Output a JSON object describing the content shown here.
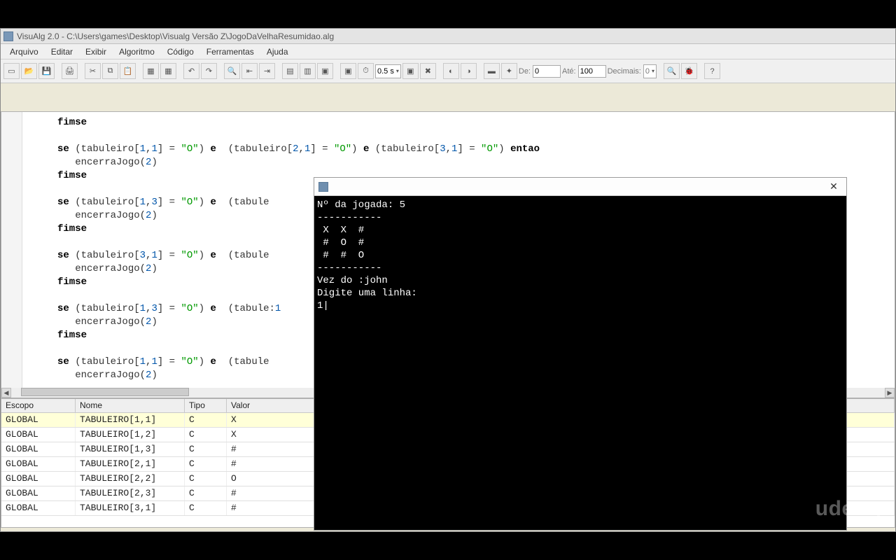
{
  "title": "VisuAlg 2.0 - C:\\Users\\games\\Desktop\\Visualg Versão Z\\JogoDaVelhaResumidao.alg",
  "menu": [
    "Arquivo",
    "Editar",
    "Exibir",
    "Algoritmo",
    "Código",
    "Ferramentas",
    "Ajuda"
  ],
  "toolbar_fields": {
    "timer_select": "0.5 s",
    "de_label": "De:",
    "de_val": "0",
    "ate_label": "Até:",
    "ate_val": "100",
    "dec_label": "Decimais:",
    "dec_val": "0"
  },
  "code_lines": [
    "fimse",
    "",
    "se (tabuleiro[1,1] = \"O\") e  (tabuleiro[2,1] = \"O\") e (tabuleiro[3,1] = \"O\") entao",
    "   encerraJogo(2)",
    "fimse",
    "",
    "se (tabuleiro[1,3] = \"O\") e  (tabule",
    "   encerraJogo(2)",
    "fimse",
    "",
    "se (tabuleiro[3,1] = \"O\") e  (tabule",
    "   encerraJogo(2)",
    "fimse",
    "",
    "se (tabuleiro[1,3] = \"O\") e  (tabule:1",
    "   encerraJogo(2)",
    "fimse",
    "",
    "se (tabuleiro[1,1] = \"O\") e  (tabule",
    "   encerraJogo(2)"
  ],
  "vars": {
    "headers": {
      "escopo": "Escopo",
      "nome": "Nome",
      "tipo": "Tipo",
      "valor": "Valor"
    },
    "rows": [
      {
        "escopo": "GLOBAL",
        "nome": "TABULEIRO[1,1]",
        "tipo": "C",
        "valor": "X",
        "hl": true
      },
      {
        "escopo": "GLOBAL",
        "nome": "TABULEIRO[1,2]",
        "tipo": "C",
        "valor": "X",
        "hl": false
      },
      {
        "escopo": "GLOBAL",
        "nome": "TABULEIRO[1,3]",
        "tipo": "C",
        "valor": "#",
        "hl": false
      },
      {
        "escopo": "GLOBAL",
        "nome": "TABULEIRO[2,1]",
        "tipo": "C",
        "valor": "#",
        "hl": false
      },
      {
        "escopo": "GLOBAL",
        "nome": "TABULEIRO[2,2]",
        "tipo": "C",
        "valor": "O",
        "hl": false
      },
      {
        "escopo": "GLOBAL",
        "nome": "TABULEIRO[2,3]",
        "tipo": "C",
        "valor": "#",
        "hl": false
      },
      {
        "escopo": "GLOBAL",
        "nome": "TABULEIRO[3,1]",
        "tipo": "C",
        "valor": "#",
        "hl": false
      }
    ]
  },
  "console": {
    "lines": [
      "Nº da jogada: 5",
      "-----------",
      " X  X  #",
      " #  O  #",
      " #  #  O",
      "-----------",
      "Vez do :john",
      "Digite uma linha:",
      "1"
    ]
  },
  "watermark": "udemy"
}
